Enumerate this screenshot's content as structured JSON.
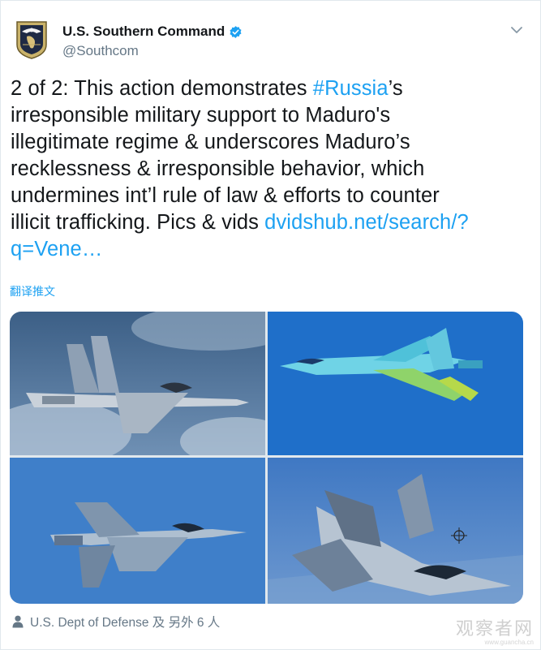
{
  "account": {
    "display_name": "U.S. Southern Command",
    "handle": "@Southcom",
    "avatar_icon": "southcom-seal-icon",
    "verified_icon": "verified-badge-icon"
  },
  "tweet": {
    "lines": [
      {
        "pre": "2 of 2: This action demonstrates ",
        "link": "#Russia",
        "post": "’s"
      },
      {
        "pre": "irresponsible military support to Maduro's",
        "link": "",
        "post": ""
      },
      {
        "pre": "illegitimate regime & underscores Maduro’s",
        "link": "",
        "post": ""
      },
      {
        "pre": "recklessness & irresponsible behavior, which",
        "link": "",
        "post": ""
      },
      {
        "pre": "undermines int’l rule of law & efforts to counter",
        "link": "",
        "post": ""
      },
      {
        "pre": "illicit trafficking. Pics & vids ",
        "link": "dvidshub.net/search/?",
        "post": ""
      },
      {
        "pre": "",
        "link": "q=Vene…",
        "post": ""
      }
    ]
  },
  "translate_label": "翻译推文",
  "media": {
    "tiles": [
      {
        "name": "photo-1",
        "alt_icon": "fighter-jet-photo"
      },
      {
        "name": "photo-2",
        "alt_icon": "fighter-jet-thermal-photo"
      },
      {
        "name": "photo-3",
        "alt_icon": "fighter-jet-photo"
      },
      {
        "name": "photo-4",
        "alt_icon": "fighter-jet-closeup-photo"
      }
    ]
  },
  "footer": {
    "tagged_text": "U.S. Dept of Defense 及 另外 6 人",
    "icon": "person-icon"
  },
  "watermark": {
    "main": "观察者网",
    "sub": "www.guancha.cn"
  },
  "colors": {
    "link": "#1da1f2",
    "text": "#14171a",
    "secondary": "#657786",
    "border": "#e1e8ed"
  }
}
